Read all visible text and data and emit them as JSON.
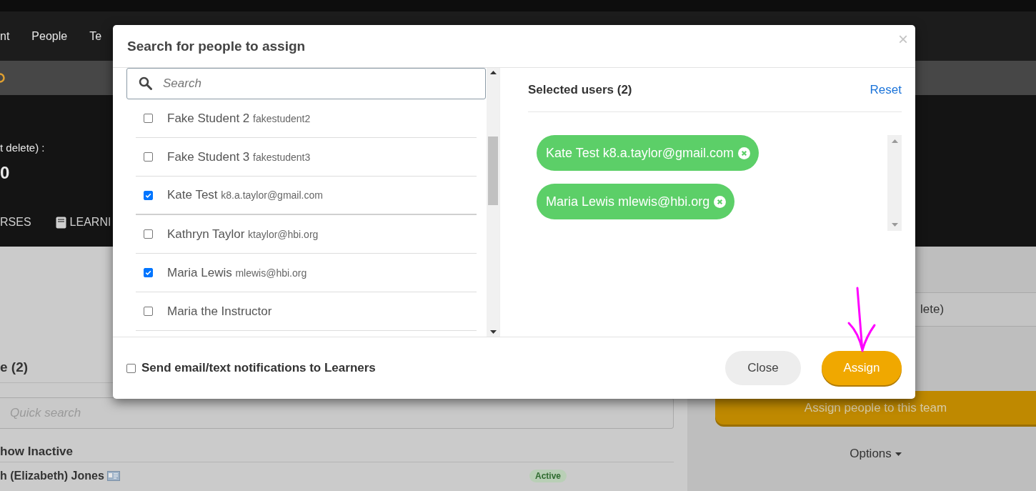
{
  "nav": {
    "items": [
      "nt",
      "People",
      "Te"
    ]
  },
  "hero": {
    "caption": "t delete) :",
    "value": "0",
    "tabs": [
      {
        "label": "RSES",
        "kind": "plain"
      },
      {
        "label": "LEARNI",
        "kind": "book"
      }
    ]
  },
  "left_panel": {
    "heading": "e (2)",
    "search": {
      "placeholder": "Quick search"
    },
    "toggle_label": "how Inactive",
    "rows": [
      {
        "name": "h (Elizabeth) Jones",
        "status": "Active"
      }
    ]
  },
  "right_panel": {
    "field_value": "lete)",
    "assign_button": "Assign people to this team",
    "options_button": "Options"
  },
  "dialog": {
    "title": "Search for people to assign",
    "close": "×",
    "search": {
      "placeholder": "Search"
    },
    "people": [
      {
        "name": "Fake Student 2",
        "detail": "fakestudent2",
        "checked": false
      },
      {
        "name": "Fake Student 3",
        "detail": "fakestudent3",
        "checked": false
      },
      {
        "name": "Kate Test",
        "detail": "k8.a.taylor@gmail.com",
        "checked": true
      },
      {
        "name": "Kathryn Taylor",
        "detail": "ktaylor@hbi.org",
        "checked": false
      },
      {
        "name": "Maria Lewis",
        "detail": "mlewis@hbi.org",
        "checked": true
      },
      {
        "name": "Maria the Instructor",
        "checked": false
      }
    ],
    "selected_title": "Selected users (2)",
    "reset": "Reset",
    "selected": [
      "Kate Test k8.a.taylor@gmail.com",
      "Maria Lewis mlewis@hbi.org"
    ],
    "notify": {
      "label": "Send email/text notifications to Learners",
      "checked": false
    },
    "buttons": [
      {
        "label": "Close",
        "kind": "secondary"
      },
      {
        "label": "Assign",
        "kind": "primary"
      }
    ]
  }
}
